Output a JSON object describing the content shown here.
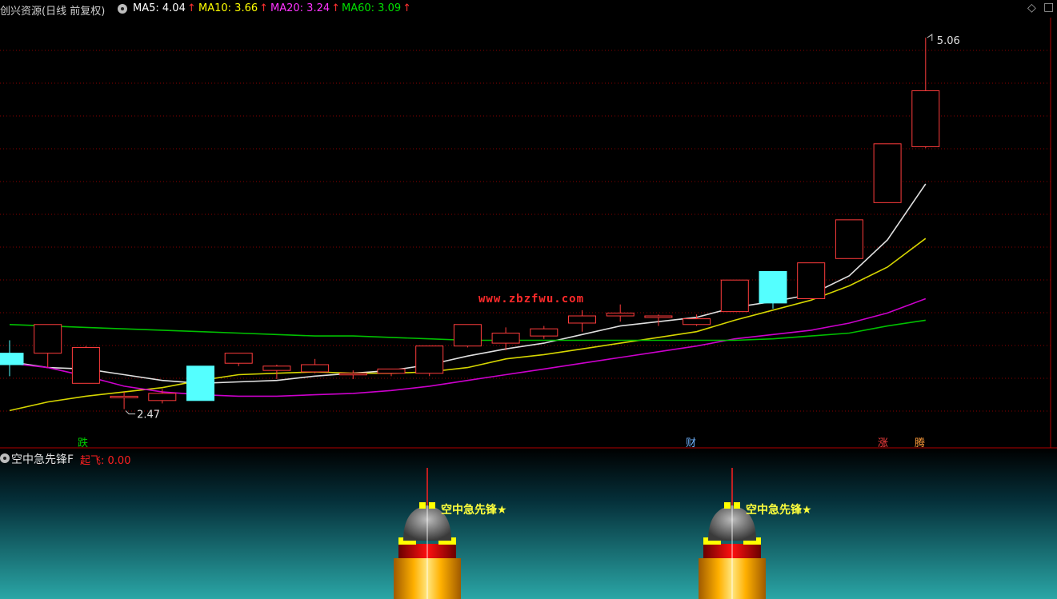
{
  "header": {
    "stock_name": "创兴资源",
    "period": "(日线 前复权)",
    "ma": [
      {
        "label": "MA5:",
        "value": "4.04",
        "color": "#ffffff"
      },
      {
        "label": "MA10:",
        "value": "3.66",
        "color": "#ffff00"
      },
      {
        "label": "MA20:",
        "value": "3.24",
        "color": "#ff00ff"
      },
      {
        "label": "MA60:",
        "value": "3.09",
        "color": "#00e000"
      }
    ]
  },
  "watermark": "www.zbzfwu.com",
  "markers": [
    {
      "text": "跌",
      "color": "#00d000"
    },
    {
      "text": "财",
      "color": "#6fb3ff"
    },
    {
      "text": "涨",
      "color": "#ff4040"
    },
    {
      "text": "腾",
      "color": "#ff9c3a"
    }
  ],
  "indicator": {
    "name": "空中急先锋F",
    "param_label": "起飞:",
    "param_value": "0.00",
    "signal_text": "空中急先锋★"
  },
  "chart_data": {
    "type": "candlestick",
    "ylim": [
      2.2,
      5.2
    ],
    "y_log": false,
    "high_annotation": "5.06",
    "low_annotation": "2.47",
    "candles": [
      {
        "o": 2.86,
        "h": 2.95,
        "l": 2.7,
        "c": 2.78
      },
      {
        "o": 2.86,
        "h": 3.06,
        "l": 2.76,
        "c": 3.06
      },
      {
        "o": 2.65,
        "h": 2.91,
        "l": 2.65,
        "c": 2.9
      },
      {
        "o": 2.55,
        "h": 2.59,
        "l": 2.47,
        "c": 2.56
      },
      {
        "o": 2.53,
        "h": 2.61,
        "l": 2.51,
        "c": 2.58
      },
      {
        "o": 2.77,
        "h": 2.77,
        "l": 2.53,
        "c": 2.53
      },
      {
        "o": 2.79,
        "h": 2.86,
        "l": 2.77,
        "c": 2.86
      },
      {
        "o": 2.74,
        "h": 2.78,
        "l": 2.68,
        "c": 2.77
      },
      {
        "o": 2.73,
        "h": 2.82,
        "l": 2.72,
        "c": 2.78
      },
      {
        "o": 2.71,
        "h": 2.74,
        "l": 2.68,
        "c": 2.72
      },
      {
        "o": 2.72,
        "h": 2.75,
        "l": 2.7,
        "c": 2.75
      },
      {
        "o": 2.72,
        "h": 2.91,
        "l": 2.7,
        "c": 2.91
      },
      {
        "o": 2.91,
        "h": 3.06,
        "l": 2.9,
        "c": 3.06
      },
      {
        "o": 2.93,
        "h": 3.04,
        "l": 2.88,
        "c": 3.0
      },
      {
        "o": 2.98,
        "h": 3.05,
        "l": 2.96,
        "c": 3.03
      },
      {
        "o": 3.07,
        "h": 3.16,
        "l": 3.01,
        "c": 3.12
      },
      {
        "o": 3.12,
        "h": 3.2,
        "l": 3.08,
        "c": 3.14
      },
      {
        "o": 3.11,
        "h": 3.13,
        "l": 3.05,
        "c": 3.12
      },
      {
        "o": 3.06,
        "h": 3.13,
        "l": 3.05,
        "c": 3.1
      },
      {
        "o": 3.15,
        "h": 3.37,
        "l": 3.15,
        "c": 3.37
      },
      {
        "o": 3.43,
        "h": 3.43,
        "l": 3.17,
        "c": 3.21
      },
      {
        "o": 3.24,
        "h": 3.49,
        "l": 3.24,
        "c": 3.49
      },
      {
        "o": 3.52,
        "h": 3.79,
        "l": 3.52,
        "c": 3.79
      },
      {
        "o": 3.91,
        "h": 4.32,
        "l": 3.91,
        "c": 4.32
      },
      {
        "o": 4.3,
        "h": 5.06,
        "l": 4.29,
        "c": 4.69
      }
    ],
    "series": [
      {
        "name": "MA5",
        "color": "#e0e0e0",
        "values": [
          2.8,
          2.76,
          2.75,
          2.71,
          2.67,
          2.65,
          2.66,
          2.67,
          2.7,
          2.72,
          2.74,
          2.78,
          2.84,
          2.89,
          2.93,
          2.99,
          3.05,
          3.08,
          3.11,
          3.18,
          3.22,
          3.27,
          3.4,
          3.65,
          4.04
        ]
      },
      {
        "name": "MA10",
        "color": "#d6d600",
        "values": [
          2.46,
          2.52,
          2.56,
          2.59,
          2.62,
          2.67,
          2.71,
          2.72,
          2.73,
          2.72,
          2.72,
          2.73,
          2.76,
          2.82,
          2.85,
          2.89,
          2.93,
          2.97,
          3.01,
          3.09,
          3.16,
          3.23,
          3.33,
          3.46,
          3.66
        ]
      },
      {
        "name": "MA20",
        "color": "#cc00cc",
        "values": [
          2.79,
          2.76,
          2.7,
          2.63,
          2.59,
          2.57,
          2.56,
          2.56,
          2.57,
          2.58,
          2.6,
          2.63,
          2.67,
          2.71,
          2.75,
          2.79,
          2.83,
          2.87,
          2.91,
          2.96,
          2.99,
          3.02,
          3.07,
          3.14,
          3.24
        ]
      },
      {
        "name": "MA60",
        "color": "#00c000",
        "values": [
          3.06,
          3.05,
          3.04,
          3.03,
          3.02,
          3.01,
          3.0,
          2.99,
          2.98,
          2.98,
          2.97,
          2.96,
          2.95,
          2.95,
          2.95,
          2.95,
          2.95,
          2.95,
          2.95,
          2.95,
          2.96,
          2.98,
          3.0,
          3.05,
          3.09
        ]
      }
    ],
    "gridlines": "dotted-red",
    "up_style": "red-hollow",
    "down_style": "cyan-filled"
  }
}
